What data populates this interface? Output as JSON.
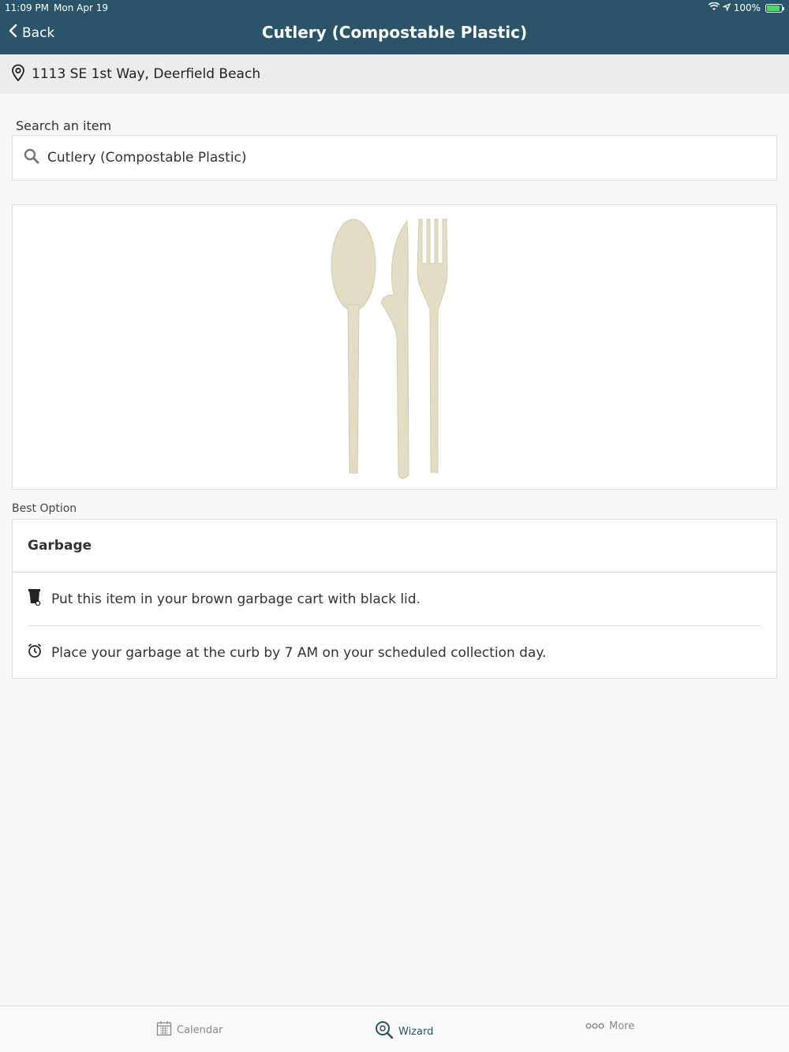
{
  "status_bar": {
    "time": "11:09 PM",
    "date": "Mon Apr 19",
    "battery": "100%"
  },
  "nav": {
    "back_label": "Back",
    "title": "Cutlery (Compostable Plastic)"
  },
  "address": {
    "text": "1113 SE 1st Way, Deerfield Beach",
    "icon": "location-pin-icon"
  },
  "search": {
    "label": "Search an item",
    "value": "Cutlery (Compostable Plastic)",
    "icon": "search-icon"
  },
  "item_image": {
    "subject": "spoon, knife and fork (compostable plastic cutlery)",
    "color": "#e6dfc8"
  },
  "best_option": {
    "section_label": "Best Option",
    "title": "Garbage",
    "instructions": [
      {
        "icon": "garbage-cart-icon",
        "text": "Put this item in your brown garbage cart with black lid."
      },
      {
        "icon": "alarm-clock-icon",
        "text": "Place your garbage at the curb by 7 AM on your scheduled collection day."
      }
    ]
  },
  "tabs": [
    {
      "label": "Calendar",
      "icon": "calendar-icon",
      "active": false
    },
    {
      "label": "Wizard",
      "icon": "wizard-search-icon",
      "active": true
    },
    {
      "label": "More",
      "icon": "more-dots-icon",
      "active": false
    }
  ],
  "colors": {
    "header_bg": "#2b5468",
    "active_tab": "#2b5468"
  }
}
